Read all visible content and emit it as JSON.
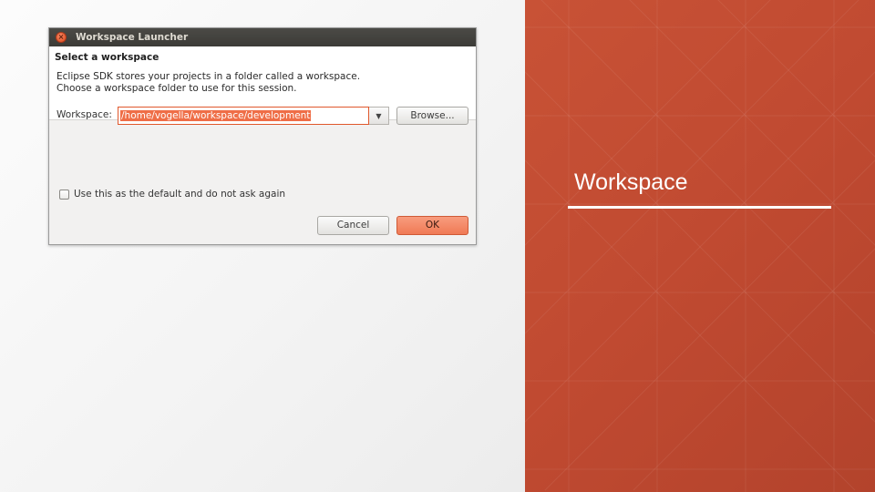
{
  "dialog": {
    "window_title": "Workspace Launcher",
    "close_glyph": "×",
    "heading": "Select a workspace",
    "description_line1": "Eclipse SDK stores your projects in a folder called a workspace.",
    "description_line2": "Choose a workspace folder to use for this session.",
    "workspace_label": "Workspace:",
    "workspace_value": "/home/vogella/workspace/development",
    "dropdown_glyph": "▼",
    "browse_label": "Browse...",
    "default_checkbox_label": "Use this as the default and do not ask again",
    "default_checked": false,
    "cancel_label": "Cancel",
    "ok_label": "OK"
  },
  "slide": {
    "title": "Workspace"
  },
  "colors": {
    "accent_orange": "#ef6e47",
    "panel_red": "#c04a31",
    "titlebar_dark": "#3c3b37"
  }
}
